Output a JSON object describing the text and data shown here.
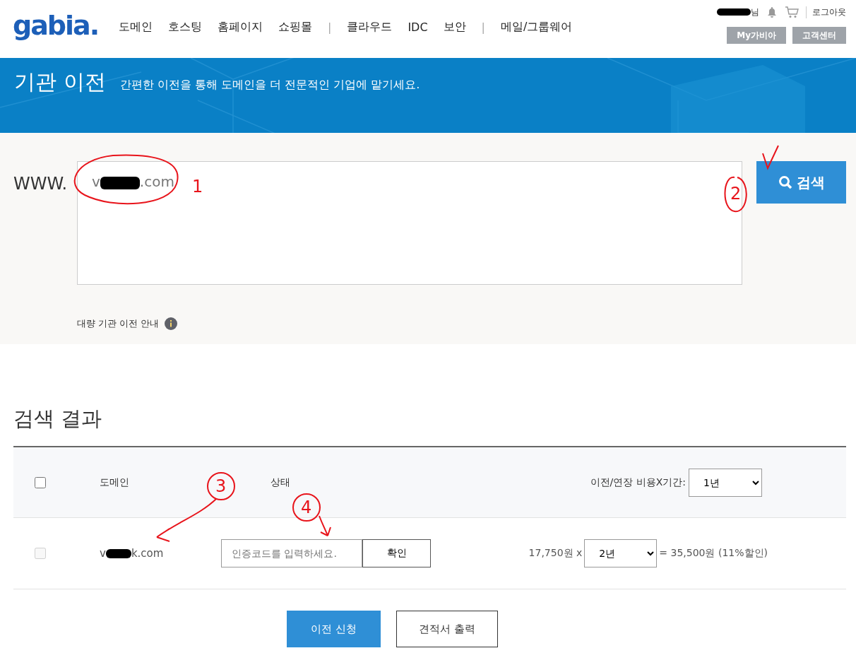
{
  "header": {
    "logo": "gabia.",
    "nav": [
      {
        "label": "도메인"
      },
      {
        "label": "호스팅"
      },
      {
        "label": "홈페이지"
      },
      {
        "label": "쇼핑몰"
      },
      {
        "kind": "divider",
        "label": "|"
      },
      {
        "label": "클라우드"
      },
      {
        "label": "IDC"
      },
      {
        "label": "보안"
      },
      {
        "kind": "divider",
        "label": "|"
      },
      {
        "label": "메일/그룹웨어"
      }
    ],
    "user": {
      "name_suffix": "님",
      "redacted": true
    },
    "logout": "로그아웃",
    "buttons": [
      "My가비아",
      "고객센터"
    ]
  },
  "banner": {
    "title": "기관 이전",
    "subtitle": "간편한 이전을 통해 도메인을 더 전문적인 기업에 맡기세요."
  },
  "search": {
    "prefix": "WWW.",
    "value": {
      "start": "v",
      "redacted": true,
      "end": ".com"
    },
    "button": "검색",
    "bulk_link": "대량 기관 이전 안내"
  },
  "results": {
    "title": "검색 결과",
    "columns": [
      {
        "kind": "checkbox",
        "checked": false
      },
      {
        "kind": "text",
        "label": "도메인"
      },
      {
        "kind": "text",
        "label": "상태"
      },
      {
        "kind": "select",
        "label": "이전/연장 비용X기간:",
        "value": "1년"
      }
    ],
    "rows": [
      {
        "checked": false,
        "disabled": true,
        "domain": {
          "start": "v",
          "redacted": true,
          "end": "k.com"
        },
        "code_placeholder": "인증코드를 입력하세요.",
        "confirm": "확인",
        "unit_price": "17,750원 x",
        "period": "2년",
        "total": "= 35,500원 (11%할인)"
      }
    ]
  },
  "actions": [
    {
      "label": "이전 신청",
      "primary": true
    },
    {
      "label": "견적서 출력",
      "primary": false
    }
  ],
  "annotations": [
    {
      "kind": "circle",
      "label": "1"
    },
    {
      "kind": "check",
      "label": "2"
    },
    {
      "kind": "arrow",
      "label": "3"
    },
    {
      "kind": "arrow",
      "label": "4"
    }
  ]
}
